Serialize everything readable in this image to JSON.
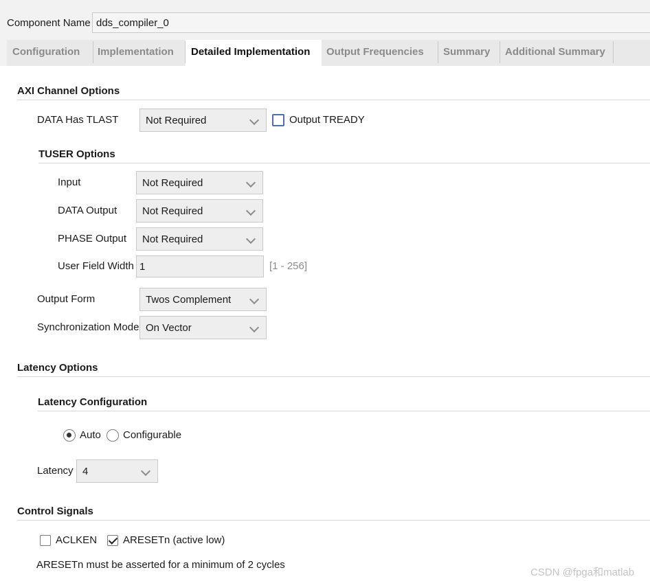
{
  "component": {
    "label": "Component Name",
    "value": "dds_compiler_0"
  },
  "tabs": [
    {
      "label": "Configuration",
      "active": false
    },
    {
      "label": "Implementation",
      "active": false
    },
    {
      "label": "Detailed Implementation",
      "active": true
    },
    {
      "label": "Output Frequencies",
      "active": false
    },
    {
      "label": "Summary",
      "active": false
    },
    {
      "label": "Additional Summary",
      "active": false
    }
  ],
  "axi": {
    "title": "AXI Channel Options",
    "data_tlast_label": "DATA Has TLAST",
    "data_tlast_value": "Not Required",
    "output_tready_label": "Output TREADY",
    "output_tready_checked": false,
    "tuser": {
      "title": "TUSER Options",
      "input_label": "Input",
      "input_value": "Not Required",
      "data_output_label": "DATA Output",
      "data_output_value": "Not Required",
      "phase_output_label": "PHASE Output",
      "phase_output_value": "Not Required",
      "user_field_width_label": "User Field Width",
      "user_field_width_value": "1",
      "user_field_width_range": "[1 - 256]"
    },
    "output_form_label": "Output Form",
    "output_form_value": "Twos Complement",
    "sync_mode_label": "Synchronization Mode",
    "sync_mode_value": "On Vector"
  },
  "latency": {
    "title": "Latency Options",
    "config_title": "Latency Configuration",
    "auto_label": "Auto",
    "auto_selected": true,
    "configurable_label": "Configurable",
    "latency_label": "Latency",
    "latency_value": "4"
  },
  "control": {
    "title": "Control Signals",
    "aclken_label": "ACLKEN",
    "aclken_checked": false,
    "aresetn_label": "ARESETn (active low)",
    "aresetn_checked": true,
    "note": "ARESETn must be asserted for a minimum of 2 cycles"
  },
  "watermark": "CSDN @fpga和matlab",
  "colors": {
    "accent_checkbox": "#4a6fb5",
    "panel_bg": "#f2f2f2",
    "field_bg": "#eeeeee"
  }
}
